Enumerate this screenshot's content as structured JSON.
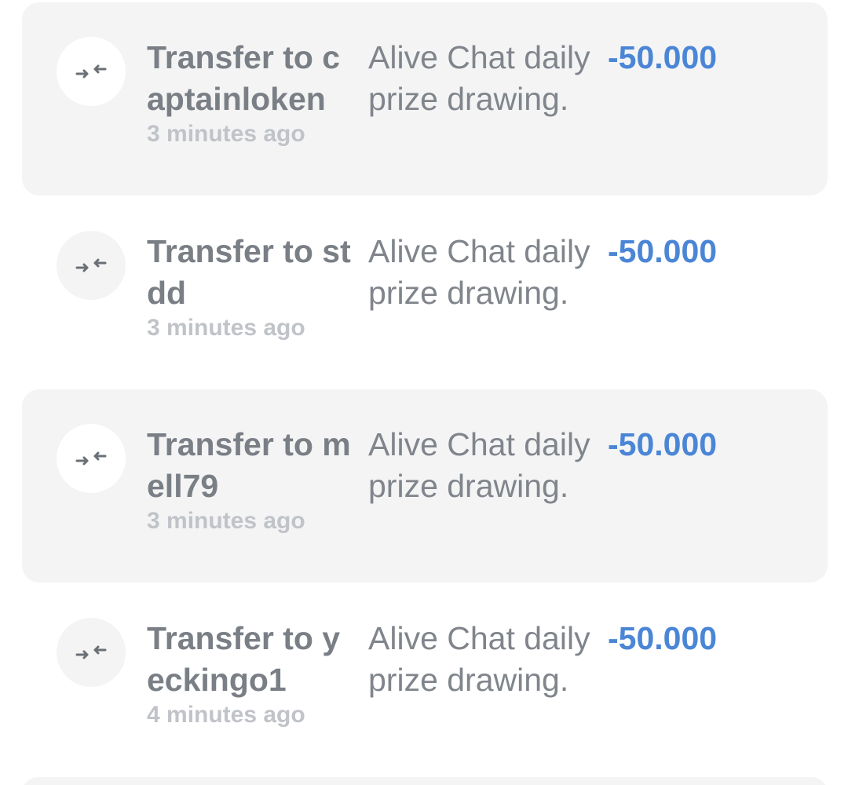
{
  "transactions": [
    {
      "icon": "transfer-arrows-icon",
      "title": "Transfer to captainloken",
      "time": "3 minutes ago",
      "memo": "Alive Chat daily prize drawing.",
      "amount": "-50.000"
    },
    {
      "icon": "transfer-arrows-icon",
      "title": "Transfer to stdd",
      "time": "3 minutes ago",
      "memo": "Alive Chat daily prize drawing.",
      "amount": "-50.000"
    },
    {
      "icon": "transfer-arrows-icon",
      "title": "Transfer to mell79",
      "time": "3 minutes ago",
      "memo": "Alive Chat daily prize drawing.",
      "amount": "-50.000"
    },
    {
      "icon": "transfer-arrows-icon",
      "title": "Transfer to yeckingo1",
      "time": "4 minutes ago",
      "memo": "Alive Chat daily prize drawing.",
      "amount": "-50.000"
    }
  ],
  "colors": {
    "amount": "#4b86d6",
    "title": "#7a7f86",
    "time": "#c0c3c8",
    "memo": "#80858c",
    "row_shaded_bg": "#f4f4f5"
  }
}
